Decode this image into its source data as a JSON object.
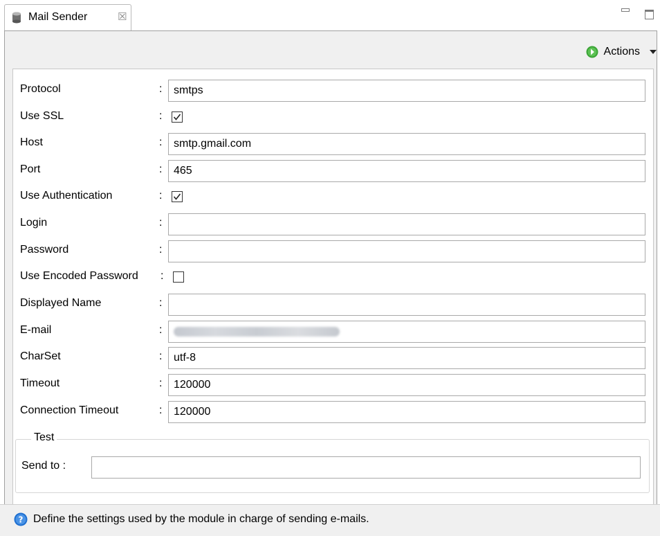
{
  "tab": {
    "title": "Mail Sender",
    "close_glyph": "☒"
  },
  "toolbar": {
    "actions_label": "Actions"
  },
  "form": {
    "protocol": {
      "label": "Protocol",
      "value": "smtps"
    },
    "use_ssl": {
      "label": "Use SSL",
      "checked": true
    },
    "host": {
      "label": "Host",
      "value": "smtp.gmail.com"
    },
    "port": {
      "label": "Port",
      "value": "465"
    },
    "use_auth": {
      "label": "Use Authentication",
      "checked": true
    },
    "login": {
      "label": "Login",
      "value": ""
    },
    "password": {
      "label": "Password",
      "value": ""
    },
    "use_encoded_password": {
      "label": "Use Encoded Password",
      "checked": false
    },
    "displayed_name": {
      "label": "Displayed Name",
      "value": ""
    },
    "email": {
      "label": "E-mail",
      "value_blurred": true
    },
    "charset": {
      "label": "CharSet",
      "value": "utf-8"
    },
    "timeout": {
      "label": "Timeout",
      "value": "120000"
    },
    "connection_timeout": {
      "label": "Connection Timeout",
      "value": "120000"
    },
    "colon": ":"
  },
  "test_group": {
    "legend": "Test",
    "send_to_label": "Send to :",
    "send_to_value": ""
  },
  "status": {
    "help_text": "Define the settings used by the module in charge of sending e-mails."
  },
  "colors": {
    "accent_green": "#3aa335",
    "help_blue": "#1e6fd0"
  }
}
